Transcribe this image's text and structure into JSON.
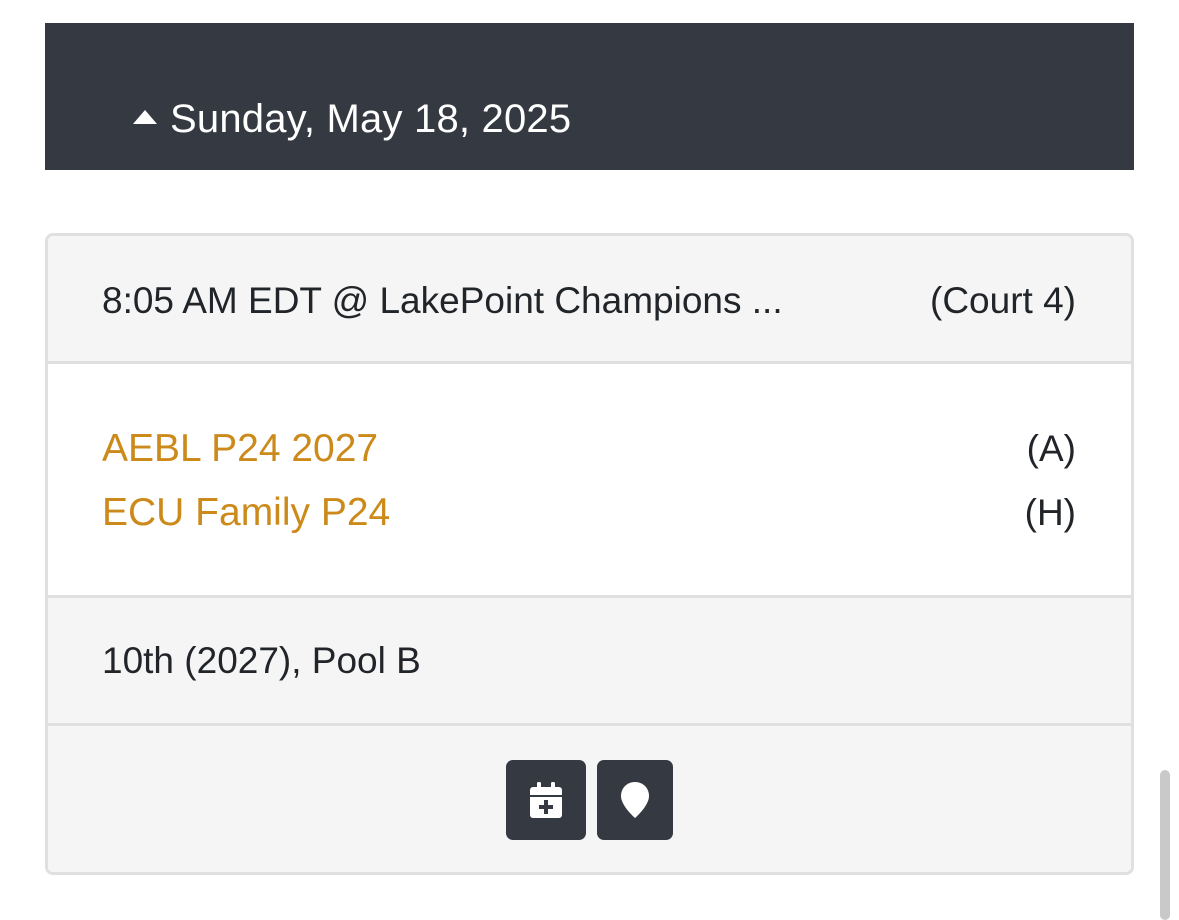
{
  "day_header": {
    "title": "Sunday, May 18, 2025",
    "expanded": true,
    "icon": "caret-up-icon"
  },
  "game": {
    "time_venue": "8:05 AM EDT @ LakePoint Champions ...",
    "court": "(Court 4)",
    "teams": [
      {
        "name": "AEBL P24 2027",
        "side": "(A)"
      },
      {
        "name": "ECU Family P24",
        "side": "(H)"
      }
    ],
    "division": "10th (2027), Pool B",
    "actions": [
      {
        "icon": "calendar-add-icon"
      },
      {
        "icon": "map-pin-icon"
      }
    ]
  },
  "colors": {
    "header_bg": "#353a42",
    "team_link": "#cc8a1b",
    "panel_bg": "#f5f5f5",
    "border": "#dfe0e1",
    "text": "#212529"
  }
}
